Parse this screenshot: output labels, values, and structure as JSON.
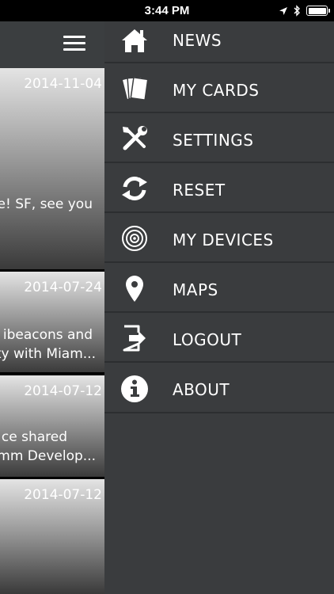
{
  "status_bar": {
    "time": "3:44 PM"
  },
  "news": [
    {
      "date": "2014-11-04",
      "text": [
        "e! SF, see you"
      ]
    },
    {
      "date": "2014-07-24",
      "text": [
        "ibeacons and",
        "ty with Miam..."
      ]
    },
    {
      "date": "2014-07-12",
      "text": [
        "ce shared",
        "mm Develop..."
      ]
    },
    {
      "date": "2014-07-12",
      "text": []
    }
  ],
  "menu": {
    "items": [
      {
        "label": "NEWS",
        "icon": "home-icon"
      },
      {
        "label": "MY CARDS",
        "icon": "cards-icon"
      },
      {
        "label": "SETTINGS",
        "icon": "tools-icon"
      },
      {
        "label": "RESET",
        "icon": "refresh-icon"
      },
      {
        "label": "MY DEVICES",
        "icon": "beacon-icon"
      },
      {
        "label": "MAPS",
        "icon": "map-pin-icon"
      },
      {
        "label": "LOGOUT",
        "icon": "logout-icon"
      },
      {
        "label": "ABOUT",
        "icon": "info-icon"
      }
    ]
  },
  "colors": {
    "menu_bg": "#3a3c3e",
    "divider": "#2c2e30",
    "header_bg": "#3b3e40"
  }
}
